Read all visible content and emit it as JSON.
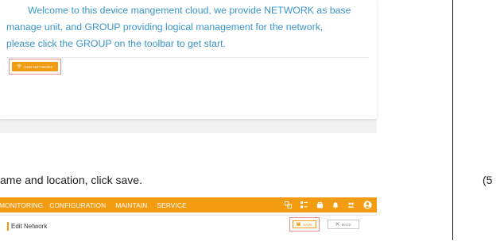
{
  "welcome": {
    "line1": "Welcome to this device mangement cloud, we provide NETWORK as base",
    "line2": "manage unit, and GROUP providing logical management for the network,",
    "line3": "please click the GROUP on the toolbar to get start.",
    "add_network_label": "ADD NETWORK"
  },
  "instruction": "ame and location, click save.",
  "step_note": "(5",
  "app": {
    "nav": [
      "MONITORING",
      "CONFIGURATION",
      "MAINTAIN",
      "SERVICE"
    ],
    "icons": [
      "network-icon",
      "grid-icon",
      "bag-icon",
      "bell-icon",
      "users-icon",
      "account-icon"
    ],
    "edit_title": "Edit Network",
    "save_label": "SAVE",
    "back_label": "BACK"
  },
  "colors": {
    "accent": "#f39c12",
    "welcome_text": "#3a95c9",
    "highlight_border": "#e98f8f"
  }
}
